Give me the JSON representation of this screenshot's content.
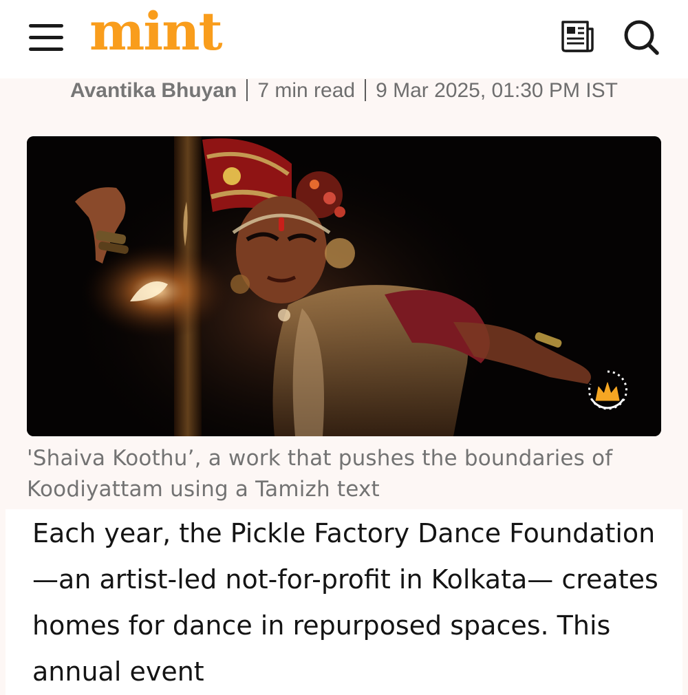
{
  "header": {
    "logo": "mint",
    "menu_icon": "hamburger-menu-icon",
    "epaper_icon": "newspaper-icon",
    "search_icon": "search-icon"
  },
  "article": {
    "author": "Avantika Bhuyan",
    "read_time": "7 min read",
    "published": "9 Mar 2025, 01:30 PM IST",
    "image_caption": "'Shaiva Koothu’, a work that pushes the boundaries of Koodiyattam using a Tamizh text",
    "premium_badge_icon": "crown-icon",
    "body": "Each year, the Pickle Factory Dance Foundation—an artist-led not-for-profit in Kolkata— creates homes for dance in repurposed spaces. This annual event"
  },
  "colors": {
    "brand": "#f99d1c",
    "page_background": "#fdf7f5",
    "meta_text": "#6e6e6e",
    "body_text": "#141414"
  }
}
